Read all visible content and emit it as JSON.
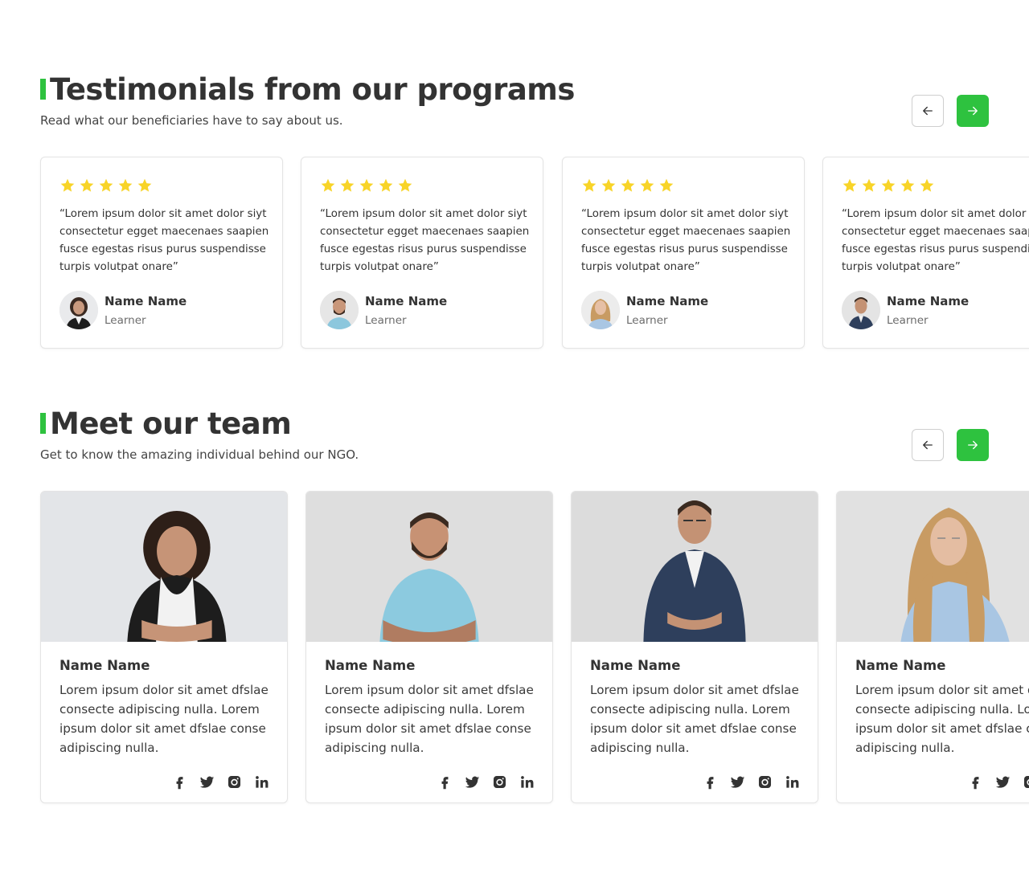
{
  "testimonials": {
    "title": "Testimonials from our programs",
    "subtitle": "Read what our beneficiaries have to say about us.",
    "cards": [
      {
        "rating": 5,
        "quote": "“Lorem ipsum dolor sit amet dolor siyt consectetur egget maecenaes saapien fusce egestas risus purus suspendisse turpis volutpat onare”",
        "name": "Name Name",
        "role": "Learner"
      },
      {
        "rating": 5,
        "quote": "“Lorem ipsum dolor sit amet dolor siyt consectetur egget maecenaes saapien fusce egestas risus purus suspendisse turpis volutpat onare”",
        "name": "Name Name",
        "role": "Learner"
      },
      {
        "rating": 5,
        "quote": "“Lorem ipsum dolor sit amet dolor siyt consectetur egget maecenaes saapien fusce egestas risus purus suspendisse turpis volutpat onare”",
        "name": "Name Name",
        "role": "Learner"
      },
      {
        "rating": 5,
        "quote": "“Lorem ipsum dolor sit amet dolor siyt consectetur egget maecenaes saapien fusce egestas risus purus suspendisse turpis volutpat onare”",
        "name": "Name Name",
        "role": "Learner"
      }
    ]
  },
  "team": {
    "title": "Meet our team",
    "subtitle": "Get to know the amazing individual behind our NGO.",
    "members": [
      {
        "name": "Name Name",
        "bio": "Lorem ipsum dolor sit amet dfslae consecte adipiscing nulla. Lorem ipsum dolor sit amet dfslae conse adipiscing nulla."
      },
      {
        "name": "Name Name",
        "bio": "Lorem ipsum dolor sit amet dfslae consecte adipiscing nulla. Lorem ipsum dolor sit amet dfslae conse adipiscing nulla."
      },
      {
        "name": "Name Name",
        "bio": "Lorem ipsum dolor sit amet dfslae consecte adipiscing nulla. Lorem ipsum dolor sit amet dfslae conse adipiscing nulla."
      },
      {
        "name": "Name Name",
        "bio": "Lorem ipsum dolor sit amet dfslae consecte adipiscing nulla. Lorem ipsum dolor sit amet dfslae conse adipiscing nulla."
      }
    ],
    "social_icons": [
      "facebook-icon",
      "twitter-icon",
      "instagram-icon",
      "linkedin-icon"
    ]
  },
  "nav": {
    "prev_icon": "arrow-left-icon",
    "next_icon": "arrow-right-icon"
  },
  "colors": {
    "accent": "#2ec23f",
    "star": "#f8d428",
    "text": "#333333",
    "muted": "#6c6c6c"
  }
}
